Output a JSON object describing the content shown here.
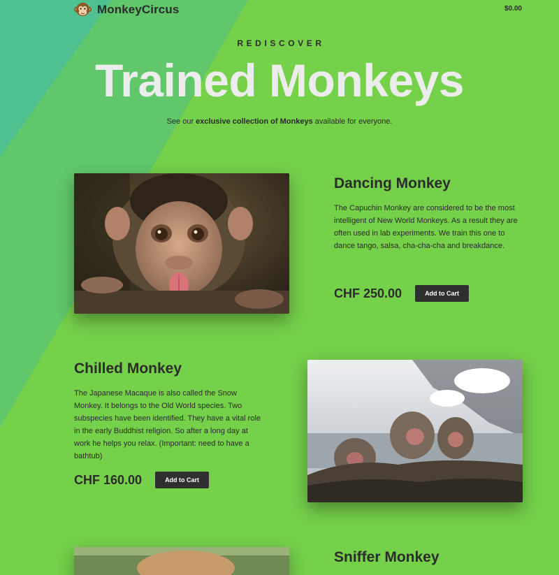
{
  "header": {
    "brand": "MonkeyCircus",
    "cart_total": "$0.00"
  },
  "hero": {
    "eyebrow": "REDISCOVER",
    "title": "Trained Monkeys",
    "subtitle_pre": "See our ",
    "subtitle_bold": "exclusive collection of Monkeys",
    "subtitle_post": " available for everyone."
  },
  "products": [
    {
      "name": "Dancing Monkey",
      "description": "The Capuchin Monkey are considered to be the most intelligent of New World Monkeys. As a result they are often used in lab experiments. We train this one to dance tango, salsa, cha-cha-cha and breakdance.",
      "price": "CHF 250.00",
      "button": "Add to Cart"
    },
    {
      "name": "Chilled Monkey",
      "description": "The Japanese Macaque is also called the Snow Monkey. It belongs to the Old World species. Two subspecies have been identified. They have a vital role in the early Buddhist religion. So after a long day at work he helps you relax. (Important: need to have a bathtub)",
      "price": "CHF 160.00",
      "button": "Add to Cart"
    },
    {
      "name": "Sniffer Monkey"
    }
  ],
  "colors": {
    "background": "#75d04a",
    "stripe_light": "#60c76a",
    "stripe_dark": "#4fc190",
    "button": "#2f2f2f",
    "title": "#ececec"
  },
  "icons": {
    "logo": "monkey-face-icon"
  }
}
